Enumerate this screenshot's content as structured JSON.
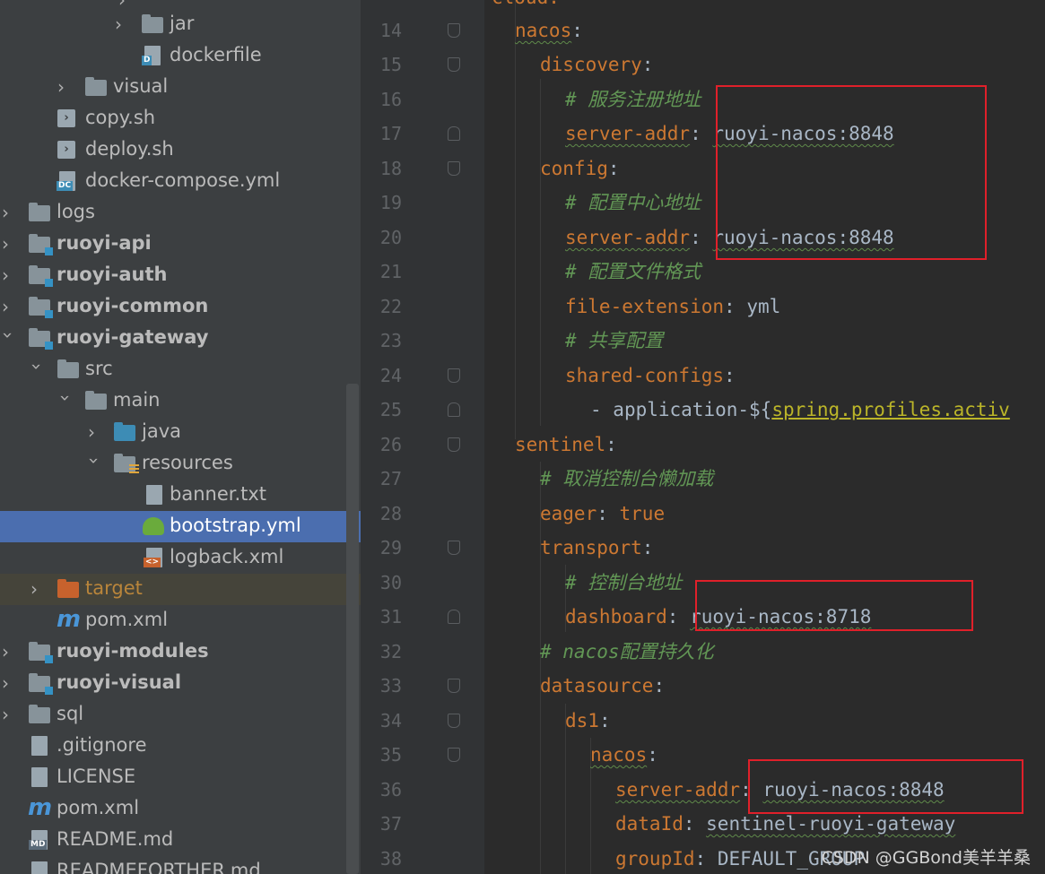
{
  "tree": {
    "items": [
      {
        "label": "jar",
        "icon": "folder-icon"
      },
      {
        "label": "dockerfile",
        "icon": "dockerfile-icon"
      },
      {
        "label": "visual",
        "icon": "folder-icon"
      },
      {
        "label": "copy.sh",
        "icon": "shell-script-icon"
      },
      {
        "label": "deploy.sh",
        "icon": "shell-script-icon"
      },
      {
        "label": "docker-compose.yml",
        "icon": "docker-compose-icon"
      },
      {
        "label": "logs",
        "icon": "folder-icon"
      },
      {
        "label": "ruoyi-api",
        "icon": "module-folder-icon"
      },
      {
        "label": "ruoyi-auth",
        "icon": "module-folder-icon"
      },
      {
        "label": "ruoyi-common",
        "icon": "module-folder-icon"
      },
      {
        "label": "ruoyi-gateway",
        "icon": "module-folder-icon"
      },
      {
        "label": "src",
        "icon": "folder-icon"
      },
      {
        "label": "main",
        "icon": "folder-icon"
      },
      {
        "label": "java",
        "icon": "source-folder-icon"
      },
      {
        "label": "resources",
        "icon": "resources-folder-icon"
      },
      {
        "label": "banner.txt",
        "icon": "text-file-icon"
      },
      {
        "label": "bootstrap.yml",
        "icon": "spring-yaml-icon"
      },
      {
        "label": "logback.xml",
        "icon": "xml-file-icon"
      },
      {
        "label": "target",
        "icon": "excluded-folder-icon"
      },
      {
        "label": "pom.xml",
        "icon": "maven-icon"
      },
      {
        "label": "ruoyi-modules",
        "icon": "module-folder-icon"
      },
      {
        "label": "ruoyi-visual",
        "icon": "module-folder-icon"
      },
      {
        "label": "sql",
        "icon": "folder-icon"
      },
      {
        "label": ".gitignore",
        "icon": "gitignore-icon"
      },
      {
        "label": "LICENSE",
        "icon": "text-file-icon"
      },
      {
        "label": "pom.xml",
        "icon": "maven-icon"
      },
      {
        "label": "README.md",
        "icon": "markdown-icon"
      },
      {
        "label": "READMEFORTHER.md",
        "icon": "markdown-icon"
      }
    ]
  },
  "editor": {
    "lines": [
      {
        "n": "14",
        "key": "nacos",
        "sep": ":"
      },
      {
        "n": "15",
        "key": "discovery",
        "sep": ":"
      },
      {
        "n": "16",
        "comment": "# 服务注册地址"
      },
      {
        "n": "17",
        "key": "server-addr",
        "sep": ": ",
        "value": "ruoyi-nacos:8848"
      },
      {
        "n": "18",
        "key": "config",
        "sep": ":"
      },
      {
        "n": "19",
        "comment": "# 配置中心地址"
      },
      {
        "n": "20",
        "key": "server-addr",
        "sep": ": ",
        "value": "ruoyi-nacos:8848"
      },
      {
        "n": "21",
        "comment": "# 配置文件格式"
      },
      {
        "n": "22",
        "key": "file-extension",
        "sep": ": ",
        "value": "yml"
      },
      {
        "n": "23",
        "comment": "# 共享配置"
      },
      {
        "n": "24",
        "key": "shared-configs",
        "sep": ":"
      },
      {
        "n": "25",
        "dash": "- ",
        "value": "application-${",
        "value2": "spring.profiles.activ"
      },
      {
        "n": "26",
        "key": "sentinel",
        "sep": ":"
      },
      {
        "n": "27",
        "comment": "# 取消控制台懒加载"
      },
      {
        "n": "28",
        "key": "eager",
        "sep": ": ",
        "kwval": "true"
      },
      {
        "n": "29",
        "key": "transport",
        "sep": ":"
      },
      {
        "n": "30",
        "comment": "# 控制台地址"
      },
      {
        "n": "31",
        "key": "dashboard",
        "sep": ": ",
        "value": "ruoyi-nacos:8718"
      },
      {
        "n": "32",
        "comment": "# nacos配置持久化"
      },
      {
        "n": "33",
        "key": "datasource",
        "sep": ":"
      },
      {
        "n": "34",
        "key": "ds1",
        "sep": ":"
      },
      {
        "n": "35",
        "key": "nacos",
        "sep": ":"
      },
      {
        "n": "36",
        "key": "server-addr",
        "sep": ": ",
        "value": "ruoyi-nacos:8848"
      },
      {
        "n": "37",
        "key": "dataId",
        "sep": ": ",
        "value": "sentinel-ruoyi-gateway"
      },
      {
        "n": "38",
        "key": "groupId",
        "sep": ": ",
        "value": "DEFAULT_GROUP"
      }
    ]
  },
  "watermark": "CSDN @GGBond美羊羊桑"
}
